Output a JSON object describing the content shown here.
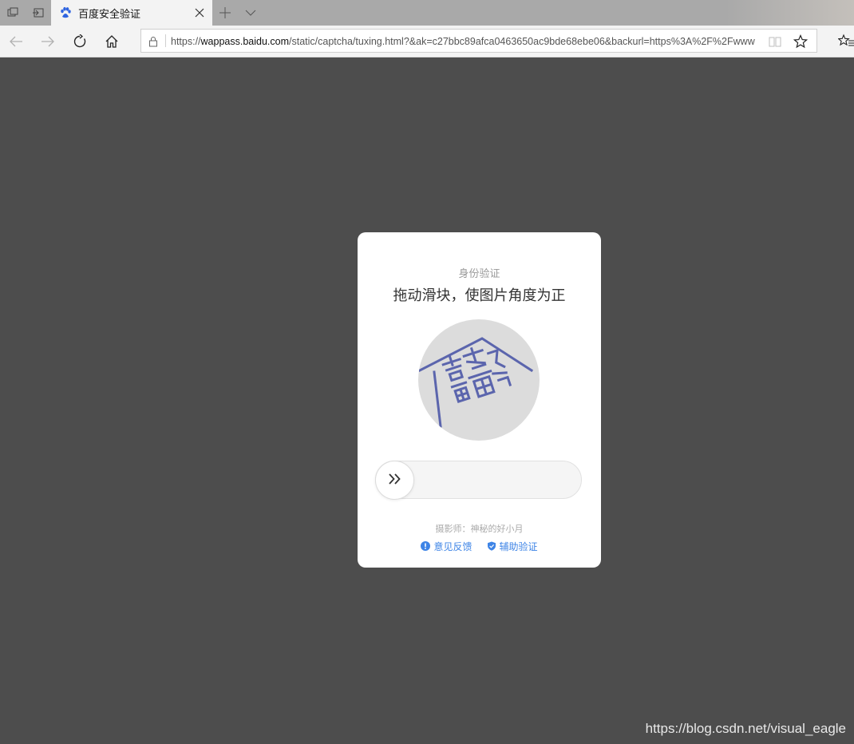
{
  "browser": {
    "tab": {
      "title": "百度安全验证",
      "favicon": "baidu-paw-icon"
    },
    "address_bar": {
      "url_prefix": "https://",
      "url_host": "wappass.baidu.com",
      "url_rest": "/static/captcha/tuxing.html?&ak=c27bbc89afca0463650ac9bde68ebe06&backurl=https%3A%2F%2Fwww"
    },
    "icons": {
      "tab_preview": "tab-preview-icon",
      "set_aside": "set-aside-tabs-icon",
      "close_tab": "close-icon",
      "new_tab": "plus-icon",
      "tab_list": "chevron-down-icon",
      "back": "arrow-left-icon",
      "forward": "arrow-right-icon",
      "refresh": "refresh-icon",
      "home": "home-icon",
      "lock": "lock-icon",
      "reading_view": "reading-view-icon",
      "favorite": "star-icon",
      "favorites_bar": "favorites-icon"
    }
  },
  "captcha": {
    "subtitle": "身份验证",
    "instruction": "拖动滑块，使图片角度为正",
    "image": "rotated-stamp-image",
    "slider": {
      "handle_icon": "double-chevron-right-icon",
      "position": 0
    },
    "credit": "摄影师：神秘的好小月",
    "links": {
      "feedback": "意见反馈",
      "assist": "辅助验证"
    },
    "colors": {
      "link": "#3e84e6",
      "stamp": "#5b65ad",
      "image_bg": "#dcdcdc"
    }
  },
  "watermark": "https://blog.csdn.net/visual_eagle",
  "page": {
    "background": "#4d4d4d"
  }
}
